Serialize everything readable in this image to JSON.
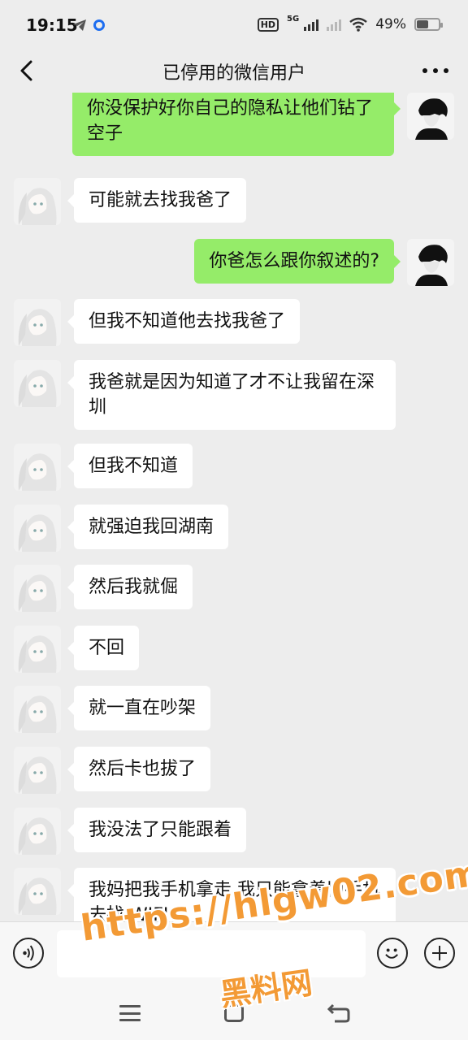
{
  "status_bar": {
    "time": "19:15",
    "network_label": "5G",
    "hd_label": "HD",
    "battery": "49%",
    "battery_level": 0.49,
    "icons": [
      "telegram-icon",
      "app-dot-icon",
      "hd-icon",
      "signal-icon",
      "wifi-icon",
      "battery-icon"
    ]
  },
  "header": {
    "title": "已停用的微信用户",
    "back_icon": "chevron-left-icon",
    "more_icon": "more-dots-icon"
  },
  "messages": [
    {
      "side": "right",
      "text": "你没保护好你自己的隐私让他们钻了空子"
    },
    {
      "side": "left",
      "text": "可能就去找我爸了"
    },
    {
      "side": "right",
      "text": "你爸怎么跟你叙述的?"
    },
    {
      "side": "left",
      "text": "但我不知道他去找我爸了"
    },
    {
      "side": "left",
      "text": "我爸就是因为知道了才不让我留在深圳"
    },
    {
      "side": "left",
      "text": "但我不知道"
    },
    {
      "side": "left",
      "text": "就强迫我回湖南"
    },
    {
      "side": "left",
      "text": "然后我就倔"
    },
    {
      "side": "left",
      "text": "不回"
    },
    {
      "side": "left",
      "text": "就一直在吵架"
    },
    {
      "side": "left",
      "text": "然后卡也拔了"
    },
    {
      "side": "left",
      "text": "我没法了只能跟着"
    },
    {
      "side": "left",
      "text": "我妈把我手机拿走 我只能拿着旧手机去找 WIFI"
    }
  ],
  "input_bar": {
    "voice_icon": "voice-icon",
    "emoji_icon": "emoji-icon",
    "plus_icon": "plus-icon",
    "input_value": ""
  },
  "nav_bar": {
    "icons": [
      "menu-icon",
      "home-icon",
      "back-icon"
    ]
  },
  "watermark": {
    "url": "https://hlgw02.com",
    "text": "黑料网"
  },
  "colors": {
    "background": "#ededed",
    "sent_bubble": "#95ec69",
    "received_bubble": "#ffffff",
    "watermark": "#f39a35"
  }
}
